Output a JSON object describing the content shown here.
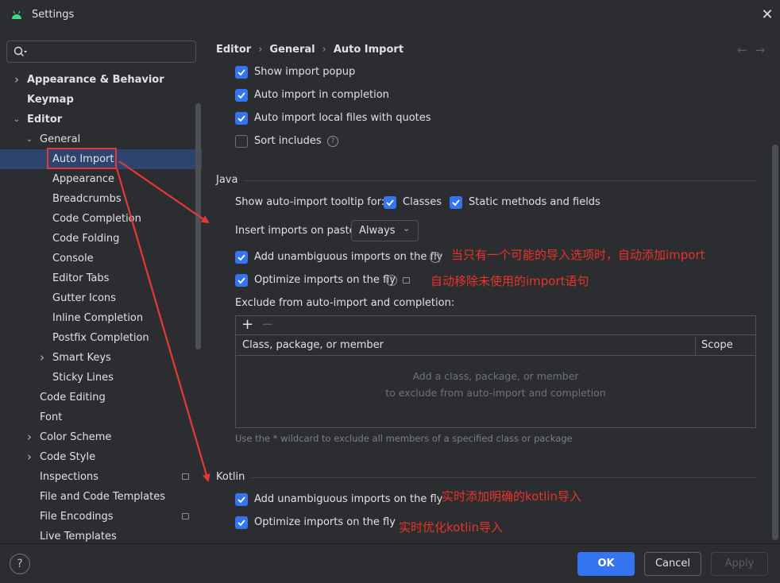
{
  "window": {
    "title": "Settings"
  },
  "search": {
    "placeholder": ""
  },
  "tree": [
    {
      "label": "Appearance & Behavior",
      "bold": true,
      "indent": 0,
      "chevron": "right"
    },
    {
      "label": "Keymap",
      "bold": true,
      "indent": 0,
      "chevron": ""
    },
    {
      "label": "Editor",
      "bold": true,
      "indent": 0,
      "chevron": "down"
    },
    {
      "label": "General",
      "bold": false,
      "indent": 1,
      "chevron": "down"
    },
    {
      "label": "Auto Import",
      "bold": false,
      "indent": 2,
      "chevron": "",
      "selected": true
    },
    {
      "label": "Appearance",
      "bold": false,
      "indent": 2,
      "chevron": ""
    },
    {
      "label": "Breadcrumbs",
      "bold": false,
      "indent": 2,
      "chevron": ""
    },
    {
      "label": "Code Completion",
      "bold": false,
      "indent": 2,
      "chevron": ""
    },
    {
      "label": "Code Folding",
      "bold": false,
      "indent": 2,
      "chevron": ""
    },
    {
      "label": "Console",
      "bold": false,
      "indent": 2,
      "chevron": ""
    },
    {
      "label": "Editor Tabs",
      "bold": false,
      "indent": 2,
      "chevron": ""
    },
    {
      "label": "Gutter Icons",
      "bold": false,
      "indent": 2,
      "chevron": ""
    },
    {
      "label": "Inline Completion",
      "bold": false,
      "indent": 2,
      "chevron": ""
    },
    {
      "label": "Postfix Completion",
      "bold": false,
      "indent": 2,
      "chevron": ""
    },
    {
      "label": "Smart Keys",
      "bold": false,
      "indent": 2,
      "chevron": "right"
    },
    {
      "label": "Sticky Lines",
      "bold": false,
      "indent": 2,
      "chevron": ""
    },
    {
      "label": "Code Editing",
      "bold": false,
      "indent": 1,
      "chevron": ""
    },
    {
      "label": "Font",
      "bold": false,
      "indent": 1,
      "chevron": ""
    },
    {
      "label": "Color Scheme",
      "bold": false,
      "indent": 1,
      "chevron": "right"
    },
    {
      "label": "Code Style",
      "bold": false,
      "indent": 1,
      "chevron": "right"
    },
    {
      "label": "Inspections",
      "bold": false,
      "indent": 1,
      "chevron": "",
      "icon": true
    },
    {
      "label": "File and Code Templates",
      "bold": false,
      "indent": 1,
      "chevron": ""
    },
    {
      "label": "File Encodings",
      "bold": false,
      "indent": 1,
      "chevron": "",
      "icon": true
    },
    {
      "label": "Live Templates",
      "bold": false,
      "indent": 1,
      "chevron": ""
    }
  ],
  "breadcrumb": [
    "Editor",
    "General",
    "Auto Import"
  ],
  "nav": {
    "back": "←",
    "forward": "→"
  },
  "general": {
    "show_import_popup": {
      "label": "Show import popup",
      "checked": true
    },
    "auto_import_completion": {
      "label": "Auto import in completion",
      "checked": true
    },
    "auto_import_local": {
      "label": "Auto import local files with quotes",
      "checked": true
    },
    "sort_includes": {
      "label": "Sort includes",
      "checked": false
    }
  },
  "java": {
    "title": "Java",
    "tooltip_label": "Show auto-import tooltip for:",
    "classes": {
      "label": "Classes",
      "checked": true
    },
    "static_methods": {
      "label": "Static methods and fields",
      "checked": true
    },
    "insert_label": "Insert imports on paste:",
    "insert_value": "Always",
    "add_unambiguous": {
      "label": "Add unambiguous imports on the fly",
      "checked": true
    },
    "optimize": {
      "label": "Optimize imports on the fly",
      "checked": true
    },
    "exclude_label": "Exclude from auto-import and completion:",
    "table": {
      "add": "+",
      "remove": "−",
      "col1": "Class, package, or member",
      "col2": "Scope",
      "empty_line1": "Add a class, package, or member",
      "empty_line2": "to exclude from auto-import and completion"
    },
    "hint": "Use the * wildcard to exclude all members of a specified class or package"
  },
  "kotlin": {
    "title": "Kotlin",
    "add_unambiguous": {
      "label": "Add unambiguous imports on the fly",
      "checked": true
    },
    "optimize": {
      "label": "Optimize imports on the fly",
      "checked": true
    }
  },
  "annotations": {
    "java_add": "当只有一个可能的导入选项时，自动添加import",
    "java_optimize": "自动移除未使用的import语句",
    "kotlin_add": "实时添加明确的kotlin导入",
    "kotlin_optimize": "实时优化kotlin导入",
    "color": "#e8342a"
  },
  "footer": {
    "help": "?",
    "ok": "OK",
    "cancel": "Cancel",
    "apply": "Apply"
  },
  "colors": {
    "accent": "#3574f0",
    "background": "#2b2d30",
    "selection": "#2e436e"
  }
}
